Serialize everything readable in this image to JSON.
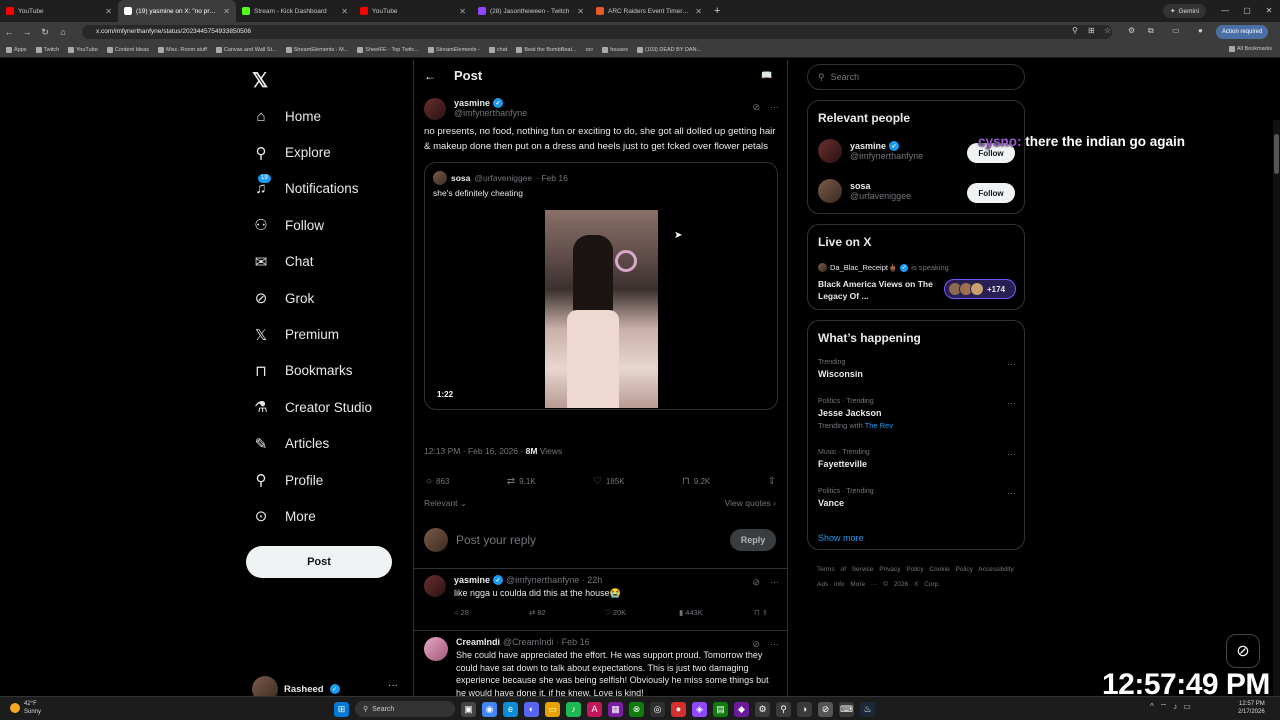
{
  "browser": {
    "tabs": [
      {
        "label": "YouTube",
        "color": "#ff0000"
      },
      {
        "label": "(19) yasmine on X: \"no presents,",
        "color": "#ffffff"
      },
      {
        "label": "Stream - Kick Dashboard",
        "color": "#53fc18"
      },
      {
        "label": "YouTube",
        "color": "#ff0000"
      },
      {
        "label": "(28) Jasontheween - Twitch",
        "color": "#9146ff"
      },
      {
        "label": "ARC Raiders Event Timers | Me",
        "color": "#e85a2c"
      }
    ],
    "gemini_label": "Gemini",
    "url": "x.com/imfynerthanfyne/status/2023445754933850506",
    "action_required": "Action required",
    "bookmarks": [
      "Apps",
      "Twitch",
      "YouTube",
      "Content Ideas",
      "Misc. Room stuff",
      "Canvas and Wall St...",
      "StreamElements - M...",
      "SheetFE - Top Twitc...",
      "StreamElements -",
      "chat",
      "Beat the BombBeat...",
      "ocr",
      "houses",
      "(103) DEAD BY DAN..."
    ],
    "all_bookmarks": "All Bookmarks"
  },
  "sidebar": {
    "items": [
      {
        "label": "Home",
        "icon": "home-icon",
        "glyph": "⌂"
      },
      {
        "label": "Explore",
        "icon": "search-icon",
        "glyph": "⚲"
      },
      {
        "label": "Notifications",
        "icon": "bell-icon",
        "glyph": "🔔",
        "badge": "19"
      },
      {
        "label": "Follow",
        "icon": "add-person-icon",
        "glyph": "👤"
      },
      {
        "label": "Chat",
        "icon": "envelope-icon",
        "glyph": "✉"
      },
      {
        "label": "Grok",
        "icon": "grok-icon",
        "glyph": "⊘"
      },
      {
        "label": "Premium",
        "icon": "x-premium-icon",
        "glyph": "𝕏"
      },
      {
        "label": "Bookmarks",
        "icon": "bookmark-icon",
        "glyph": "🔖"
      },
      {
        "label": "Creator Studio",
        "icon": "flask-icon",
        "glyph": "⚗"
      },
      {
        "label": "Articles",
        "icon": "article-icon",
        "glyph": "📝"
      },
      {
        "label": "Profile",
        "icon": "person-icon",
        "glyph": "👤"
      },
      {
        "label": "More",
        "icon": "more-circle-icon",
        "glyph": "⋯"
      }
    ],
    "post_button": "Post",
    "account_name": "Rasheed"
  },
  "main": {
    "header_title": "Post",
    "tweet": {
      "name": "yasmine",
      "handle": "@imfynerthanfyne",
      "text": "no presents, no food, nothing fun or exciting to do, she got all dolled up getting hair & makeup done then put on a dress and heels just to get fcked over flower petals",
      "quote": {
        "name": "sosa",
        "handle": "@urfaveniggee",
        "date": "· Feb 16",
        "text": "she's definitely cheating",
        "duration": "1:22"
      },
      "time": "12:13 PM · Feb 16, 2026 · ",
      "views_count": "8M",
      "views_label": " Views",
      "replies": "863",
      "reposts": "9.1K",
      "likes": "185K",
      "bookmarks": "9.2K",
      "relevant": "Relevant ⌄",
      "view_quotes": "View quotes ›"
    },
    "reply_placeholder": "Post your reply",
    "reply_button": "Reply",
    "replies": [
      {
        "name": "yasmine",
        "handle": "@imfynerthanfyne · 22h",
        "text": "like ngga u coulda did this at the house😭",
        "replies": "28",
        "reposts": "82",
        "likes": "20K",
        "views": "443K"
      },
      {
        "name": "CreamIndi",
        "handle": "@CreamIndi · Feb 16",
        "text": "She could have appreciated the effort. He was support proud. Tomorrow they could have sat down to talk about expectations. This is just two damaging experience because she was being selfish! Obviously he miss some things but he would have done it, if he knew. Love is kind!"
      }
    ]
  },
  "right": {
    "search_placeholder": "Search",
    "relevant_title": "Relevant people",
    "people": [
      {
        "name": "yasmine",
        "handle": "@imfynerthanfyne",
        "button": "Follow",
        "verified": true
      },
      {
        "name": "sosa",
        "handle": "@urfaveniggee",
        "button": "Follow",
        "verified": false
      }
    ],
    "live_title": "Live on X",
    "live": {
      "host": "Da_Blac_Receipt🖕🏾",
      "status": "is speaking",
      "title": "Black America Views on The Legacy Of ...",
      "count": "+174"
    },
    "happening_title": "What’s happening",
    "trends": [
      {
        "category": "Trending",
        "topic": "Wisconsin",
        "with": ""
      },
      {
        "category": "Politics · Trending",
        "topic": "Jesse Jackson",
        "with": "Trending with",
        "with_link": "The Rev"
      },
      {
        "category": "Music · Trending",
        "topic": "Fayetteville",
        "with": ""
      },
      {
        "category": "Politics · Trending",
        "topic": "Vance",
        "with": ""
      }
    ],
    "show_more": "Show more",
    "footer": "Terms of Service  Privacy Policy  Cookie Policy  Accessibility  Ads info  More ···  © 2026 X Corp."
  },
  "overlay": {
    "chat_user": "cysno:",
    "chat_text": "there the indian go again",
    "clock": "12:57:49 PM"
  },
  "taskbar": {
    "temp": "42°F",
    "condition": "Sunny",
    "search": "Search",
    "time": "12:57 PM",
    "date": "2/17/2026"
  }
}
